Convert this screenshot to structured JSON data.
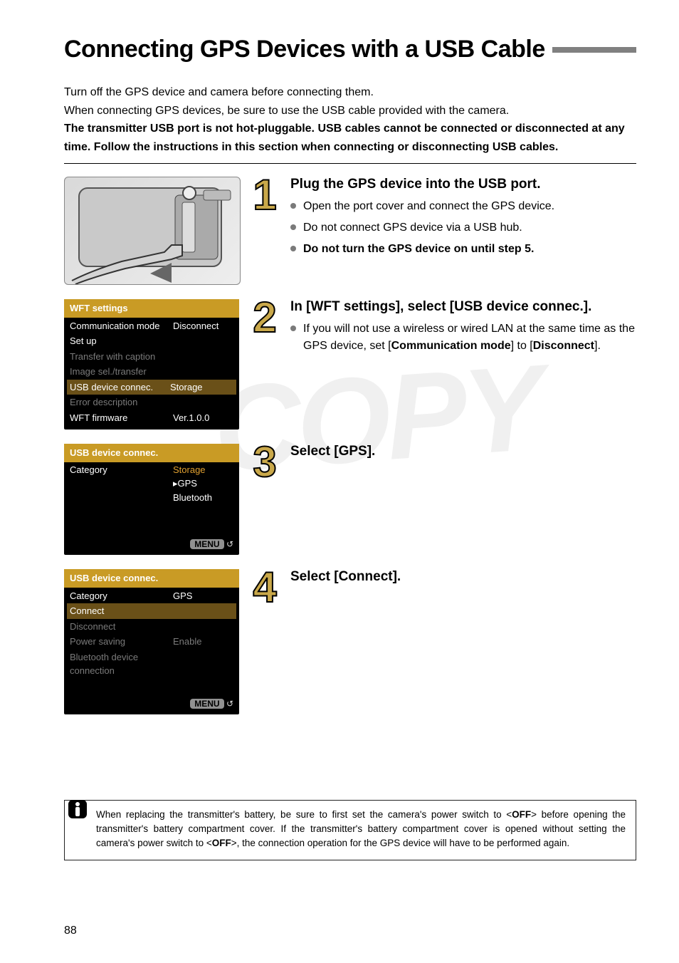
{
  "page_number": "88",
  "title": "Connecting GPS Devices with a USB Cable",
  "watermark": "COPY",
  "intro": {
    "line1": "Turn off the GPS device and camera before connecting them.",
    "line2": "When connecting GPS devices, be sure to use the USB cable provided with the camera.",
    "line3_bold": "The transmitter USB port is not hot-pluggable. USB cables cannot be connected or disconnected at any time. Follow the instructions in this section when connecting or disconnecting USB cables."
  },
  "steps": [
    {
      "num": "1",
      "title": "Plug the GPS device into the USB port.",
      "bullets": [
        {
          "text": "Open the port cover and connect the GPS device."
        },
        {
          "text": "Do not connect GPS device via a USB hub."
        },
        {
          "bold": "Do not turn the GPS device on until step 5."
        }
      ]
    },
    {
      "num": "2",
      "title": "In [WFT settings], select [USB device connec.].",
      "bullets": [
        {
          "html": "If you will not use a wireless or wired LAN at the same time as the GPS device, set [<b>Communication mode</b>] to [<b>Disconnect</b>]."
        }
      ]
    },
    {
      "num": "3",
      "title": "Select [GPS].",
      "bullets": []
    },
    {
      "num": "4",
      "title": "Select [Connect].",
      "bullets": []
    }
  ],
  "osd": {
    "menu_return": "MENU",
    "screen1": {
      "header": "WFT settings",
      "rows": [
        {
          "k": "Communication mode",
          "v": "Disconnect"
        },
        {
          "k": "Set up",
          "v": ""
        },
        {
          "k": "Transfer with caption",
          "v": "",
          "dim": true
        },
        {
          "k": "Image sel./transfer",
          "v": "",
          "dim": true
        },
        {
          "k": "USB device connec.",
          "v": "Storage",
          "hl": true
        },
        {
          "k": "Error description",
          "v": "",
          "dim": true
        },
        {
          "k": "WFT firmware",
          "v": "Ver.1.0.0"
        }
      ]
    },
    "screen2": {
      "header": "USB device connec.",
      "category_label": "Category",
      "options": [
        "Storage",
        "GPS",
        "Bluetooth"
      ],
      "selected_index": 1
    },
    "screen3": {
      "header": "USB device connec.",
      "rows": [
        {
          "k": "Category",
          "v": "GPS"
        },
        {
          "k": "Connect",
          "v": "",
          "hl": true
        },
        {
          "k": "Disconnect",
          "v": "",
          "dim": true
        },
        {
          "k": "Power saving",
          "v": "Enable",
          "dim": true
        },
        {
          "k": "Bluetooth device connection",
          "v": "",
          "dim": true
        }
      ]
    }
  },
  "note": {
    "text_before_off1": "When replacing the transmitter's battery, be sure to first set the camera's power switch to <",
    "off": "OFF",
    "text_mid": "> before opening the transmitter's battery compartment cover. If the transmitter's battery compartment cover is opened without setting the camera's power switch to <",
    "text_after": ">, the connection operation for the GPS device will have to be performed again."
  }
}
